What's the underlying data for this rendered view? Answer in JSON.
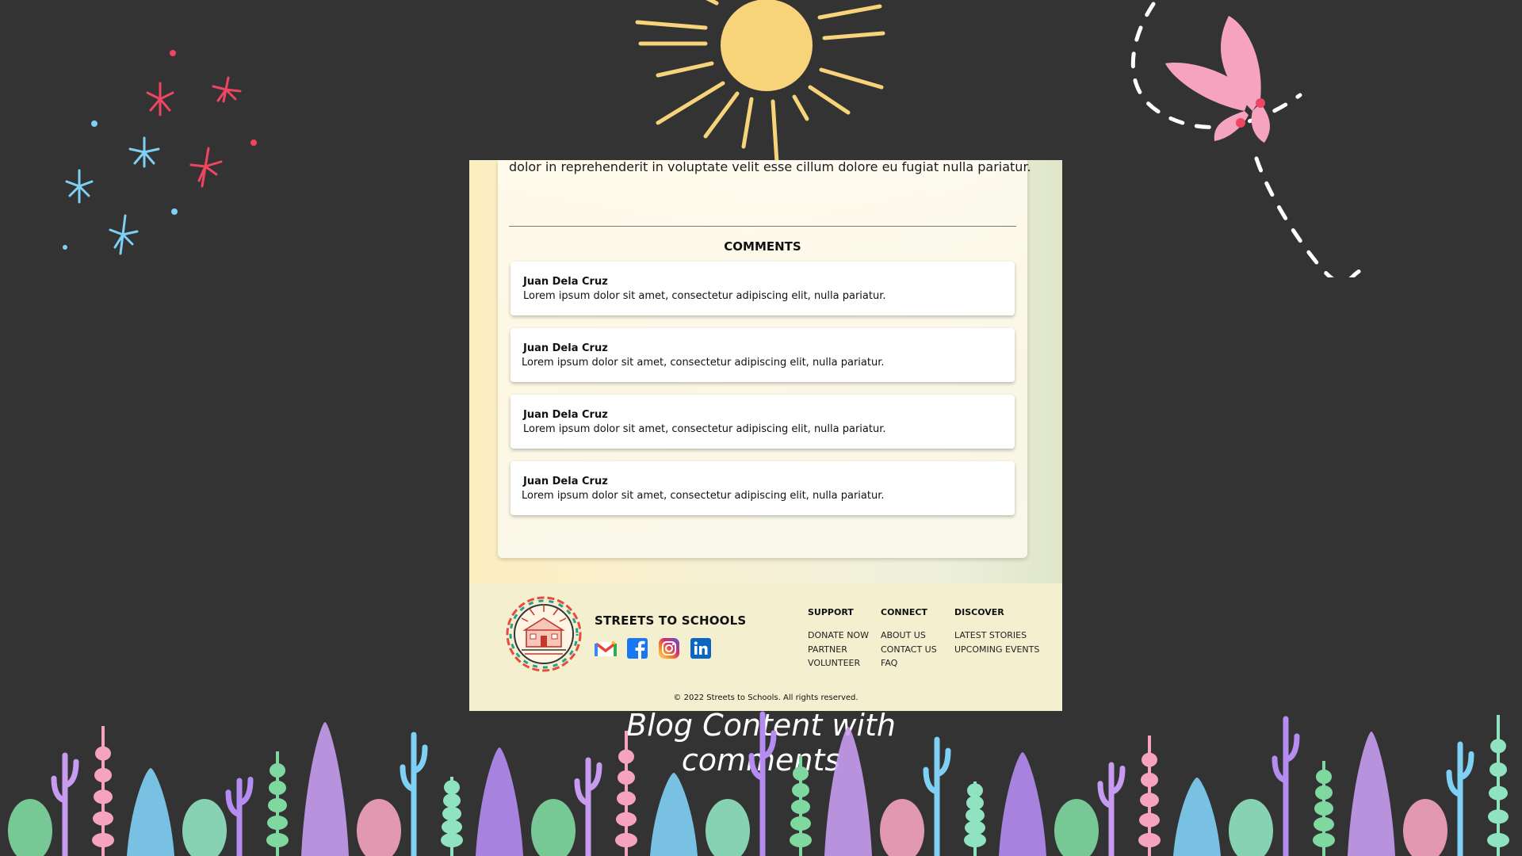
{
  "article": {
    "body_tail": "dolor in reprehenderit in voluptate velit esse cillum dolore eu fugiat nulla pariatur."
  },
  "comments": {
    "title": "COMMENTS",
    "items": [
      {
        "author": "Juan Dela Cruz",
        "text": "Lorem ipsum dolor sit amet, consectetur adipiscing elit, nulla pariatur."
      },
      {
        "author": "Juan Dela Cruz",
        "text": "Lorem ipsum dolor sit amet, consectetur adipiscing elit, nulla pariatur."
      },
      {
        "author": "Juan Dela Cruz",
        "text": "Lorem ipsum dolor sit amet, consectetur adipiscing elit, nulla pariatur."
      },
      {
        "author": "Juan Dela Cruz",
        "text": "Lorem ipsum dolor sit amet, consectetur adipiscing elit, nulla pariatur."
      }
    ]
  },
  "footer": {
    "brand": "STREETS TO SCHOOLS",
    "social": [
      "gmail-icon",
      "facebook-icon",
      "instagram-icon",
      "linkedin-icon"
    ],
    "columns": [
      {
        "heading": "SUPPORT",
        "links": [
          "DONATE NOW",
          "PARTNER",
          "VOLUNTEER"
        ]
      },
      {
        "heading": "CONNECT",
        "links": [
          "ABOUT US",
          "CONTACT US",
          "FAQ"
        ]
      },
      {
        "heading": "DISCOVER",
        "links": [
          "LATEST STORIES",
          "UPCOMING EVENTS"
        ]
      }
    ],
    "copyright": "© 2022 Streets to Schools. All rights reserved."
  },
  "caption": "Blog Content with comments",
  "colors": {
    "background": "#333333",
    "sun": "#f7d37a",
    "sparkle_red": "#ef4562",
    "sparkle_blue": "#7fd0f5",
    "butterfly": "#f6a3c0",
    "footer_bg": "#f4efcf"
  }
}
